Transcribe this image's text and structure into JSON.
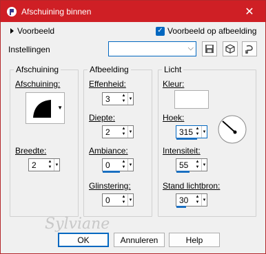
{
  "window": {
    "title": "Afschuining binnen",
    "close_glyph": "✕"
  },
  "preview": {
    "expander_label": "Voorbeeld",
    "checkbox_label": "Voorbeeld op afbeelding",
    "checked": true
  },
  "settings": {
    "label": "Instellingen",
    "value": ""
  },
  "bevel": {
    "group_title": "Afschuining",
    "shape_label": "Afschuining:",
    "width_label": "Breedte:",
    "width_value": "2"
  },
  "image": {
    "group_title": "Afbeelding",
    "smoothness_label": "Effenheid:",
    "smoothness_value": "3",
    "depth_label": "Diepte:",
    "depth_value": "2",
    "ambience_label": "Ambiance:",
    "ambience_value": "0",
    "shininess_label": "Glinstering:",
    "shininess_value": "0"
  },
  "light": {
    "group_title": "Licht",
    "color_label": "Kleur:",
    "color": "#ffffff",
    "angle_label": "Hoek:",
    "angle_value": "315",
    "intensity_label": "Intensiteit:",
    "intensity_value": "55",
    "elevation_label": "Stand lichtbron:",
    "elevation_value": "30"
  },
  "buttons": {
    "ok": "OK",
    "cancel": "Annuleren",
    "help": "Help"
  },
  "watermark": "Sylviane",
  "colors": {
    "titlebar": "#cf1f25",
    "accent": "#0067c0"
  },
  "icons": [
    "app-icon",
    "close-icon",
    "expand-arrow-icon",
    "checkbox-check-icon",
    "save-preset-icon",
    "reset-icon",
    "delete-preset-icon",
    "bevel-shape-icon",
    "angle-dial-icon"
  ]
}
